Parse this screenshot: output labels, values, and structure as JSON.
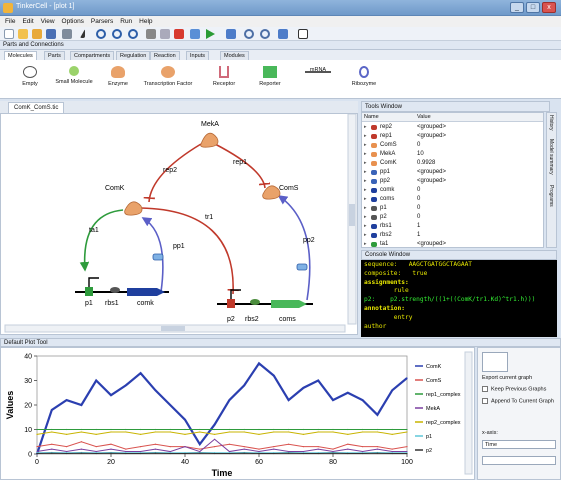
{
  "window": {
    "title": "TinkerCell - [plot 1]",
    "min": "_",
    "max": "□",
    "close": "x"
  },
  "menu": [
    "File",
    "Edit",
    "View",
    "Options",
    "Parsers",
    "Run",
    "Help"
  ],
  "toolbar_icons": [
    "new-icon",
    "open-icon",
    "open-folder-icon",
    "save-icon",
    "print-icon",
    "pointer-icon",
    "undo-icon",
    "redo-icon",
    "refresh-icon",
    "cut-icon",
    "copy-icon",
    "delete-icon",
    "table-icon",
    "play-icon",
    "wrench-icon",
    "zoom-in-icon",
    "zoom-out-icon",
    "fill-icon",
    "text-color-icon"
  ],
  "parts_panel": {
    "title": "Parts and Connections",
    "tabs": [
      "Molecules",
      "Parts",
      "Compartments",
      "Regulation",
      "Reaction",
      "Inputs",
      "Modules"
    ],
    "active_tab": "Molecules",
    "items": [
      "Empty",
      "Small Molecule",
      "Enzyme",
      "Transcription Factor",
      "Receptor",
      "Reporter",
      "mRNA",
      "Ribozyme"
    ]
  },
  "canvas": {
    "file_tab": "ComK_ComS.tic",
    "nodes": {
      "meka": "MekA",
      "comk": "ComK",
      "coms": "ComS"
    },
    "edges": {
      "rep2": "rep2",
      "rep1": "rep1",
      "tr1": "tr1",
      "ta1": "ta1",
      "pp1": "pp1",
      "pp2": "pp2"
    },
    "parts1": {
      "p1": "p1",
      "rbs1": "rbs1",
      "comk": "comk"
    },
    "parts2": {
      "p2": "p2",
      "rbs2": "rbs2",
      "coms": "coms"
    }
  },
  "tools_window": {
    "title": "Tools Window",
    "col_name": "Name",
    "col_value": "Value",
    "rows": [
      {
        "name": "rep2",
        "value": "<grouped>",
        "color": "#c0392b"
      },
      {
        "name": "rep1",
        "value": "<grouped>",
        "color": "#c0392b"
      },
      {
        "name": "ComS",
        "value": "0",
        "color": "#e8914f"
      },
      {
        "name": "MekA",
        "value": "10",
        "color": "#e8914f"
      },
      {
        "name": "ComK",
        "value": "0.9928",
        "color": "#e8914f"
      },
      {
        "name": "pp1",
        "value": "<grouped>",
        "color": "#3a63b8"
      },
      {
        "name": "pp2",
        "value": "<grouped>",
        "color": "#3a63b8"
      },
      {
        "name": "comk",
        "value": "0",
        "color": "#1f3f9e"
      },
      {
        "name": "coms",
        "value": "0",
        "color": "#1f3f9e"
      },
      {
        "name": "p1",
        "value": "0",
        "color": "#555555"
      },
      {
        "name": "p2",
        "value": "0",
        "color": "#555555"
      },
      {
        "name": "rbs1",
        "value": "1",
        "color": "#1f3f9e"
      },
      {
        "name": "rbs2",
        "value": "1",
        "color": "#1f3f9e"
      },
      {
        "name": "ta1",
        "value": "<grouped>",
        "color": "#2e9b3c"
      }
    ],
    "side_tabs": [
      "History",
      "Model summary",
      "Programs"
    ]
  },
  "console": {
    "title": "Console Window",
    "lines": [
      {
        "text": "sequence:   AAGCTGATGGCTAGAAT",
        "color": "#e6e600",
        "bold": false
      },
      {
        "text": "composite:   true",
        "color": "#e6e600",
        "bold": false
      },
      {
        "text": "assignments:",
        "color": "#e6e600",
        "bold": true
      },
      {
        "text": "        rule",
        "color": "#e6e600",
        "bold": false
      },
      {
        "text": "p2:    p2.strength/((1+((ComK/tr1.Kd)^tr1.h)))",
        "color": "#33ee33",
        "bold": false
      },
      {
        "text": "annotation:",
        "color": "#e6e600",
        "bold": true
      },
      {
        "text": "        entry",
        "color": "#e6e600",
        "bold": false
      },
      {
        "text": "author",
        "color": "#e6e600",
        "bold": false
      }
    ]
  },
  "plot_tool": {
    "title": "Default Plot Tool",
    "export_label": "Export current graph",
    "keep_previous": "Keep Previous Graphs",
    "append": "Append To Current Graph",
    "xaxis_label": "x-axis:",
    "xaxis_value": "Time"
  },
  "chart_data": {
    "type": "line",
    "xlabel": "Time",
    "ylabel": "Values",
    "xlim": [
      0,
      100
    ],
    "ylim": [
      0,
      40
    ],
    "xticks": [
      0,
      20,
      40,
      60,
      80,
      100
    ],
    "yticks": [
      0,
      10,
      20,
      30,
      40
    ],
    "x": [
      0,
      4,
      8,
      12,
      16,
      20,
      24,
      28,
      32,
      36,
      40,
      44,
      48,
      52,
      56,
      60,
      64,
      68,
      72,
      76,
      80,
      84,
      88,
      92,
      96,
      100
    ],
    "series": [
      {
        "name": "ComK",
        "color": "#2b3fb0",
        "width": 2.2,
        "values": [
          0,
          18,
          22,
          20,
          30,
          24,
          28,
          33,
          26,
          20,
          14,
          4,
          12,
          22,
          28,
          37,
          32,
          22,
          27,
          30,
          22,
          25,
          22,
          16,
          26,
          31
        ]
      },
      {
        "name": "ComS",
        "color": "#d9534f",
        "width": 1,
        "values": [
          3,
          4,
          3,
          5,
          3,
          4,
          2,
          3,
          4,
          3,
          3,
          2,
          3,
          4,
          3,
          2,
          3,
          4,
          3,
          3,
          2,
          4,
          3,
          3,
          2,
          3
        ]
      },
      {
        "name": "rep1_complex",
        "color": "#2e9b3c",
        "width": 1,
        "values": [
          10,
          10,
          10,
          10,
          10,
          10,
          10,
          10,
          10,
          10,
          10,
          10,
          10,
          10,
          10,
          10,
          10,
          10,
          10,
          10,
          10,
          10,
          10,
          10,
          10,
          10
        ]
      },
      {
        "name": "MekA",
        "color": "#7b3fa0",
        "width": 1,
        "values": [
          1,
          2,
          1,
          2,
          1,
          2,
          1,
          1,
          2,
          1,
          3,
          1,
          6,
          1,
          2,
          1,
          2,
          1,
          1,
          2,
          1,
          2,
          1,
          2,
          1,
          1
        ]
      },
      {
        "name": "rep2_complex",
        "color": "#c8b400",
        "width": 1,
        "values": [
          8,
          9,
          8,
          9,
          8,
          9,
          9,
          8,
          9,
          9,
          8,
          9,
          8,
          9,
          9,
          8,
          9,
          9,
          8,
          9,
          9,
          8,
          9,
          9,
          8,
          9
        ]
      },
      {
        "name": "p1",
        "color": "#5fc7d9",
        "width": 1,
        "values": [
          0.5,
          0.6,
          0.5,
          0.6,
          0.5,
          0.6,
          0.5,
          0.5,
          0.6,
          0.5,
          0.5,
          0.6,
          0.5,
          0.5,
          0.6,
          0.5,
          0.5,
          0.6,
          0.5,
          0.5,
          0.6,
          0.5,
          0.5,
          0.6,
          0.5,
          0.5
        ]
      },
      {
        "name": "p2",
        "color": "#333333",
        "width": 1,
        "values": [
          0.2,
          0.3,
          0.2,
          0.3,
          0.2,
          0.3,
          0.2,
          0.2,
          0.3,
          0.2,
          0.2,
          0.3,
          0.2,
          0.2,
          0.3,
          0.2,
          0.2,
          0.3,
          0.2,
          0.2,
          0.3,
          0.2,
          0.2,
          0.3,
          0.2,
          0.2
        ]
      }
    ]
  }
}
